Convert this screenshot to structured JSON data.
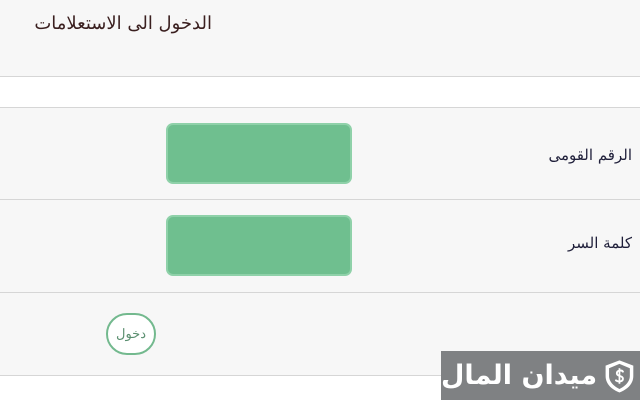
{
  "login": {
    "title": "الدخول الى الاستعلامات",
    "fields": [
      {
        "label": "الرقم القومى",
        "value": "",
        "placeholder": ""
      },
      {
        "label": "كلمة السر",
        "value": "",
        "placeholder": ""
      }
    ],
    "submit_label": "دخول"
  },
  "brand": {
    "name": "ميدان المال",
    "logo_icon": "shield-dollar-icon",
    "badge_color": "#7f8183"
  },
  "colors": {
    "field_fill": "#6fbf8f",
    "button_border": "#73b98e",
    "row_background": "#f7f7f7"
  }
}
